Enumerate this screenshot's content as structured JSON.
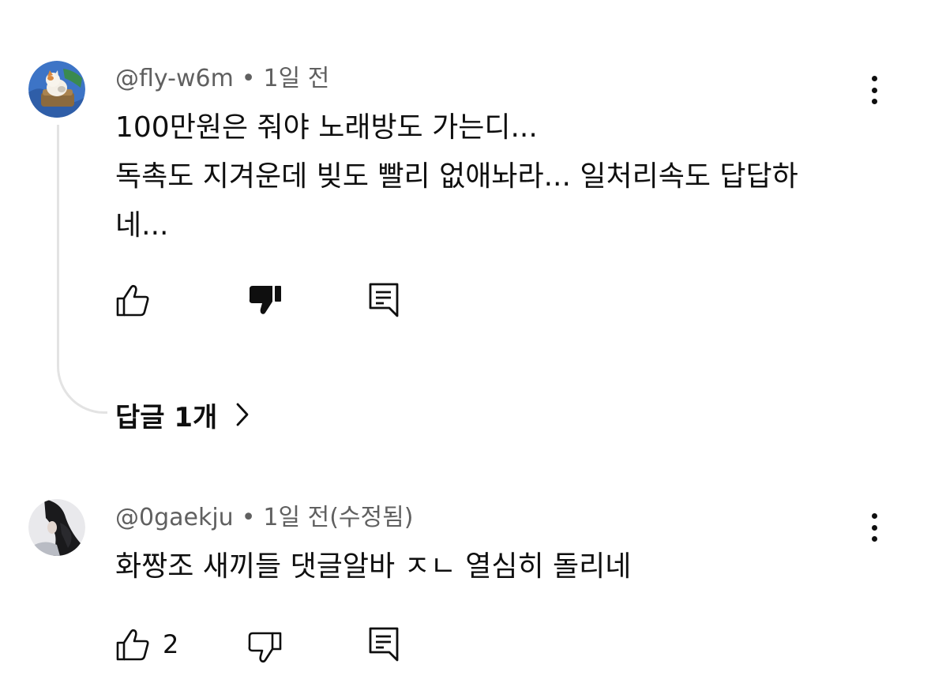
{
  "comments": [
    {
      "handle": "@fly-w6m",
      "separator": "•",
      "time": "1일 전",
      "lines": [
        "100만원은 줘야 노래방도 가는디...",
        "독촉도 지겨운데 빚도 빨리 없애놔라... 일처리속도 답답하",
        "네..."
      ],
      "like_count": "",
      "replies_label": "답글 1개"
    },
    {
      "handle": "@0gaekju",
      "separator": "•",
      "time": "1일 전(수정됨)",
      "lines": [
        "화짱조 새끼들 댓글알바 ㅈㄴ 열심히 돌리네"
      ],
      "like_count": "2"
    }
  ],
  "colors": {
    "text": "#0f0f0f",
    "meta": "#606060",
    "thread_line": "#e3e3e3"
  },
  "icons": [
    "like-icon",
    "dislike-icon",
    "dislike-filled-icon",
    "reply-icon",
    "more-vertical-icon",
    "chevron-right-icon"
  ]
}
